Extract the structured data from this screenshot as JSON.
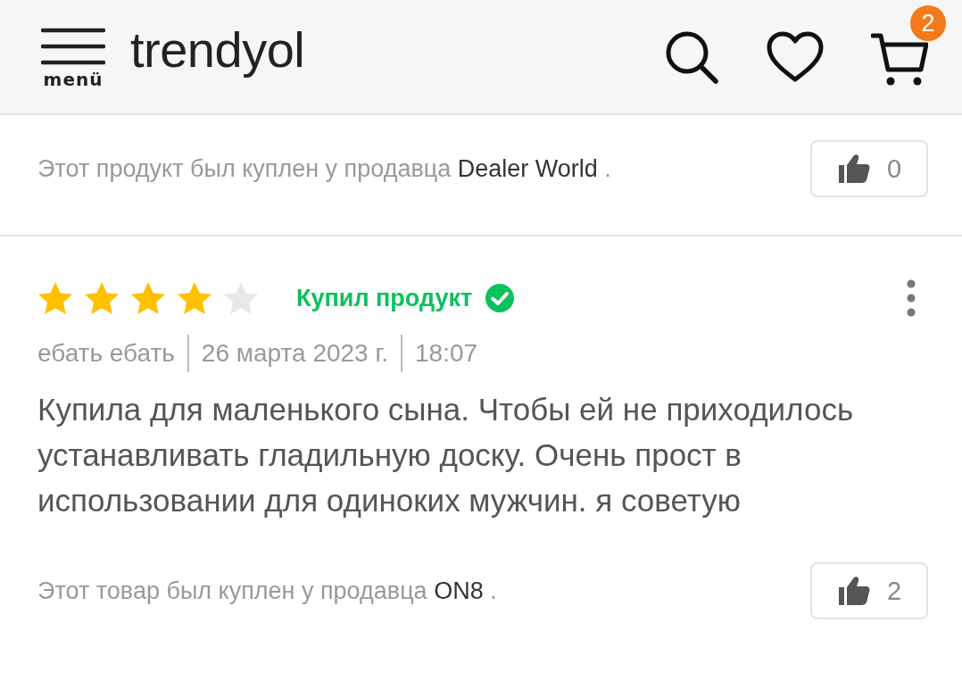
{
  "header": {
    "menu_label": "menü",
    "logo": "trendyol",
    "cart_count": "2"
  },
  "reviews": [
    {
      "kind": "partial",
      "seller_prefix": "Этот продукт был куплен у продавца ",
      "seller": "Dealer World",
      "seller_suffix": " .",
      "likes": "0"
    },
    {
      "kind": "full",
      "stars": 4,
      "verified": "Купил продукт",
      "author": "ебать ебать",
      "date": "26 марта 2023 г.",
      "time": "18:07",
      "body": "Купила для маленького сына. Чтобы ей не приходилось устанавливать гладильную доску. Очень прост в использовании для одиноких мужчин. я советую",
      "seller_prefix": "Этот товар был куплен у продавца ",
      "seller": "ON8",
      "seller_suffix": " .",
      "likes": "2"
    }
  ]
}
